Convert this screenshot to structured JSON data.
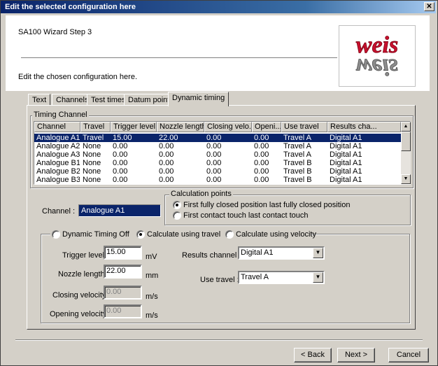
{
  "window": {
    "title": "Edit the selected configuration here",
    "close_icon": "close-icon"
  },
  "header": {
    "step": "SA100 Wizard Step 3",
    "logo_top": "weis",
    "logo_bottom": "weis"
  },
  "description": "Edit the chosen configuration here.",
  "tabs": [
    {
      "label": "Text",
      "active": false
    },
    {
      "label": "Channels",
      "active": false
    },
    {
      "label": "Test times",
      "active": false
    },
    {
      "label": "Datum points",
      "active": false
    },
    {
      "label": "Dynamic timing",
      "active": true
    }
  ],
  "timing_channel": {
    "legend": "Timing Channel",
    "columns": [
      "Channel",
      "Travel",
      "Trigger level",
      "Nozzle length",
      "Closing velo...",
      "Openi...",
      "Use travel",
      "Results cha..."
    ],
    "rows": [
      [
        "Analogue A1",
        "Travel",
        "15.00",
        "22.00",
        "0.00",
        "0.00",
        "Travel A",
        "Digital A1"
      ],
      [
        "Analogue A2",
        "None",
        "0.00",
        "0.00",
        "0.00",
        "0.00",
        "Travel A",
        "Digital A1"
      ],
      [
        "Analogue A3",
        "None",
        "0.00",
        "0.00",
        "0.00",
        "0.00",
        "Travel A",
        "Digital A1"
      ],
      [
        "Analogue B1",
        "None",
        "0.00",
        "0.00",
        "0.00",
        "0.00",
        "Travel B",
        "Digital A1"
      ],
      [
        "Analogue B2",
        "None",
        "0.00",
        "0.00",
        "0.00",
        "0.00",
        "Travel B",
        "Digital A1"
      ],
      [
        "Analogue B3",
        "None",
        "0.00",
        "0.00",
        "0.00",
        "0.00",
        "Travel B",
        "Digital A1"
      ]
    ],
    "selected_row": 0
  },
  "channel": {
    "label": "Channel :",
    "value": "Analogue A1"
  },
  "calculation_points": {
    "legend": "Calculation points",
    "options": [
      "First fully closed position last fully closed position",
      "First contact touch last contact touch"
    ],
    "selected": 0
  },
  "mode": {
    "options": [
      "Dynamic Timing Off",
      "Calculate using travel",
      "Calculate using velocity"
    ],
    "selected": 1
  },
  "fields": {
    "trigger_level": {
      "label": "Trigger level :",
      "value": "15.00",
      "unit": "mV"
    },
    "nozzle_length": {
      "label": "Nozzle length :",
      "value": "22.00",
      "unit": "mm"
    },
    "closing_velocity": {
      "label": "Closing velocity :",
      "value": "0.00",
      "unit": "m/s"
    },
    "opening_velocity": {
      "label": "Opening velocity :",
      "value": "0.00",
      "unit": "m/s"
    },
    "results_channel": {
      "label": "Results channel :",
      "value": "Digital A1"
    },
    "use_travel": {
      "label": "Use travel :",
      "value": "Travel A"
    }
  },
  "buttons": {
    "back": "< Back",
    "next": "Next >",
    "cancel": "Cancel"
  },
  "colors": {
    "title_start": "#0a246a",
    "selection": "#0a246a",
    "face": "#d4d0c8",
    "logo_red": "#c8102e"
  }
}
